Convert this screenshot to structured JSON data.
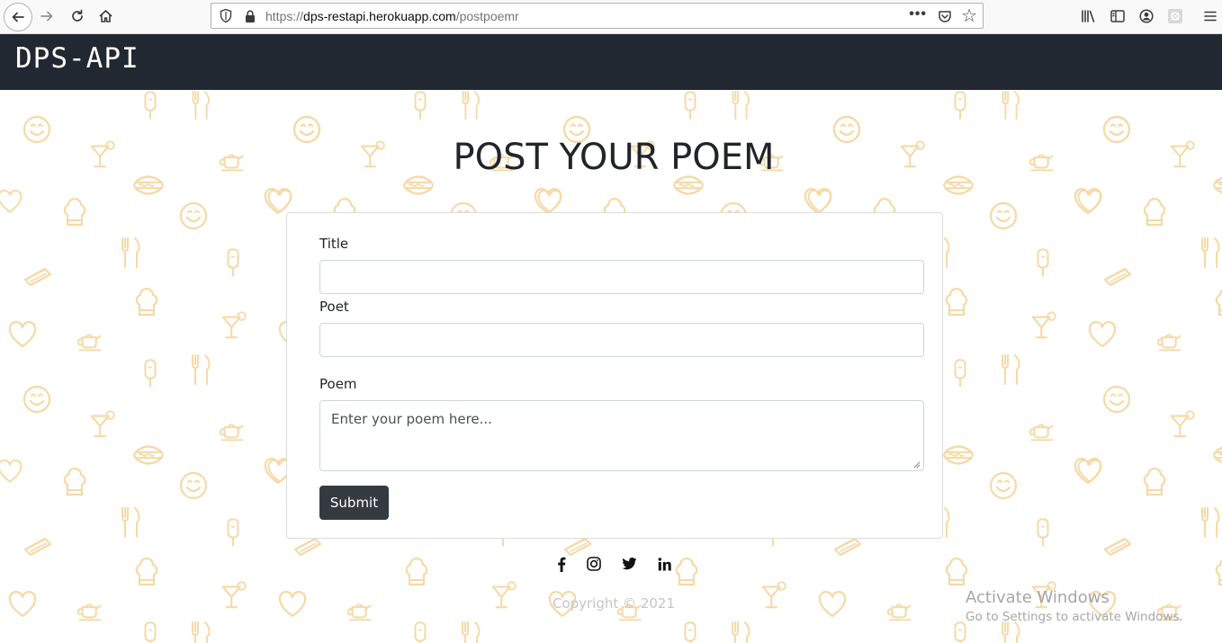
{
  "browser": {
    "url_prefix": "https://",
    "url_host": "dps-restapi.herokuapp.com",
    "url_path": "/postpoemr",
    "more_label": "•••"
  },
  "navbar": {
    "brand": "DPS-API",
    "background": "#222831"
  },
  "page": {
    "heading": "POST YOUR POEM",
    "pattern_color": "#f6d9a6"
  },
  "form": {
    "title_label": "Title",
    "title_value": "",
    "poet_label": "Poet",
    "poet_value": "",
    "poem_label": "Poem",
    "poem_placeholder": "Enter your poem here...",
    "submit_label": "Submit"
  },
  "footer": {
    "social_icons": [
      "facebook-icon",
      "instagram-icon",
      "twitter-icon",
      "linkedin-icon"
    ],
    "copyright": "Copyright © 2021"
  },
  "os_watermark": {
    "title": "Activate Windows",
    "subtitle": "Go to Settings to activate Windows."
  }
}
